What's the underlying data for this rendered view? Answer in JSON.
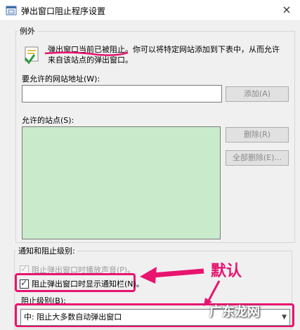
{
  "window": {
    "title": "弹出窗口阻止程序设置",
    "close_glyph": "×"
  },
  "exceptions": {
    "group_label": "例外",
    "info_text": "弹出窗口当前已被阻止。你可以将特定网站添加到下表中，从而允许来自该站点的弹出窗口。",
    "address_label": "要允许的网站地址(W):",
    "address_value": "",
    "add_button": "添加(A)",
    "allowed_label": "允许的站点(S):",
    "allowed_sites": [],
    "remove_button": "删除(R)",
    "remove_all_button": "全部删除(E)..."
  },
  "notify": {
    "group_label": "通知和阻止级别:",
    "play_sound": {
      "label": "阻止弹出窗口时播放声音(P)。",
      "checked": true,
      "enabled": false
    },
    "show_bar": {
      "label": "阻止弹出窗口时显示通知栏(N)。",
      "checked": true,
      "enabled": true
    },
    "level_label": "阻止级别(B):",
    "level_value": "中: 阻止大多数自动弹出窗口",
    "select_arrow": "▼"
  },
  "annotations": {
    "callout": "默认",
    "watermark": "广东龙网",
    "accent_color": "#e8146f"
  },
  "colors": {
    "allowed_list_bg": "#c9ebcb"
  }
}
